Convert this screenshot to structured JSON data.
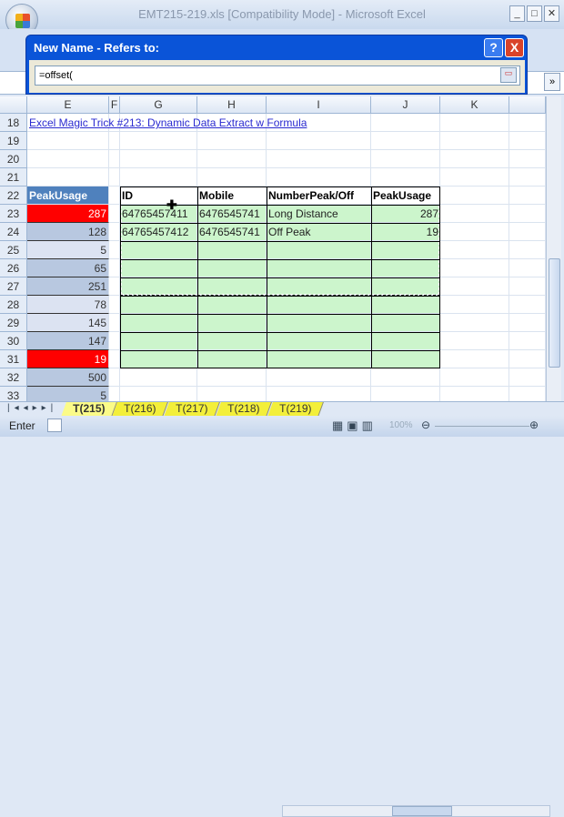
{
  "window": {
    "title": "EMT215-219.xls  [Compatibility Mode] - Microsoft Excel"
  },
  "dialog": {
    "title": "New Name - Refers to:",
    "help": "?",
    "close": "X",
    "value": "=offset("
  },
  "columns": [
    "E",
    "F",
    "G",
    "H",
    "I",
    "J",
    "K"
  ],
  "rows": [
    "18",
    "19",
    "20",
    "21",
    "22",
    "23",
    "24",
    "25",
    "26",
    "27",
    "28",
    "29",
    "30",
    "31",
    "32",
    "33"
  ],
  "link_text": "Excel Magic Trick #213: Dynamic Data Extract w Formula",
  "peak_header": "PeakUsage",
  "peak_values": [
    "287",
    "128",
    "5",
    "65",
    "251",
    "78",
    "145",
    "147",
    "19",
    "500",
    "5"
  ],
  "peak_highlight_color": "#ff0000",
  "table": {
    "headers": [
      "ID",
      "Mobile",
      "NumberPeak/Off",
      "PeakUsage"
    ],
    "rows": [
      [
        "64765457411",
        "6476545741",
        "Long Distance",
        "287"
      ],
      [
        "64765457412",
        "6476545741",
        "Off Peak",
        "19"
      ]
    ]
  },
  "sheet_tabs": [
    "T(215)",
    "T(216)",
    "T(217)",
    "T(218)",
    "T(219)"
  ],
  "status": {
    "mode": "Enter",
    "zoom": "100%"
  }
}
